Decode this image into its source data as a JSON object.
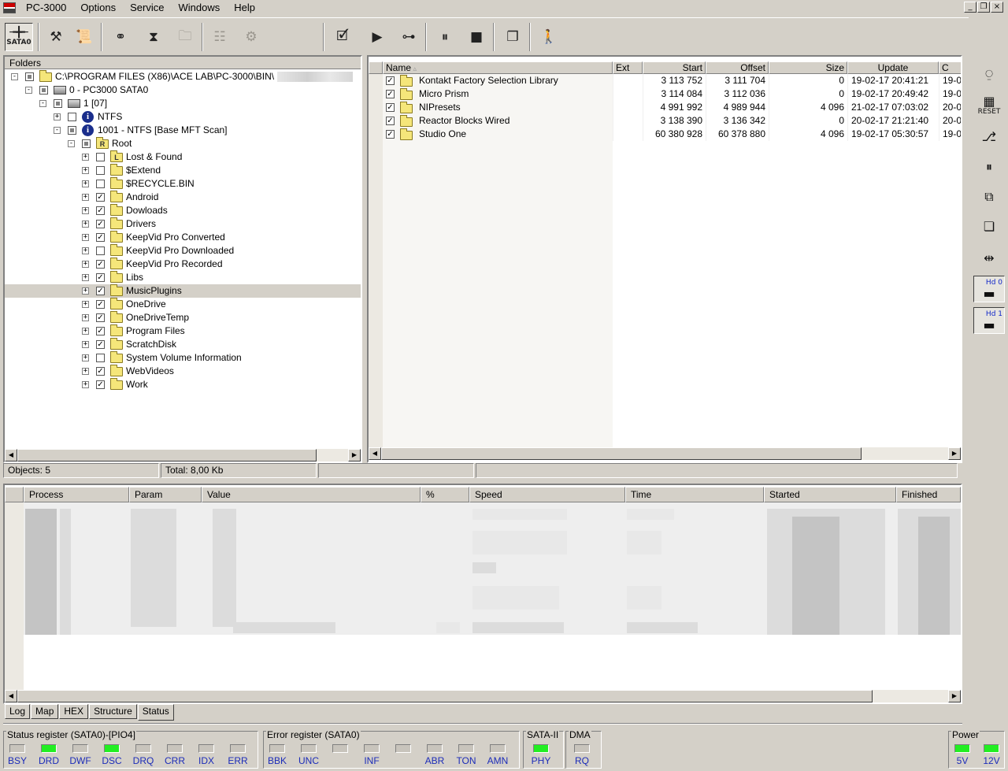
{
  "menu": {
    "app_title": "PC-3000",
    "items": [
      "Options",
      "Service",
      "Windows",
      "Help"
    ]
  },
  "window_controls": {
    "minimize": "_",
    "restore": "❐",
    "close": "×"
  },
  "toolbar": {
    "sata_label": "SATA0"
  },
  "folders": {
    "header": "Folders",
    "tree": [
      {
        "label": "C:\\PROGRAM FILES (X86)\\ACE LAB\\PC-3000\\BIN\\",
        "level": 0,
        "expander": "-",
        "check": "part",
        "icon": "multi-folder"
      },
      {
        "label": "0 - PC3000 SATA0",
        "level": 1,
        "expander": "-",
        "check": "part",
        "icon": "drive"
      },
      {
        "label": "1 [07]",
        "level": 2,
        "expander": "-",
        "check": "part",
        "icon": "disk"
      },
      {
        "label": "NTFS",
        "level": 3,
        "expander": "+",
        "check": "none",
        "icon": "info"
      },
      {
        "label": "1001 - NTFS [Base MFT Scan]",
        "level": 3,
        "expander": "-",
        "check": "part",
        "icon": "info"
      },
      {
        "label": "Root",
        "level": 4,
        "expander": "-",
        "check": "part",
        "icon": "folder-r",
        "icon_letter": "R"
      },
      {
        "label": "Lost & Found",
        "level": 5,
        "expander": "+",
        "check": "none",
        "icon": "folder-l",
        "icon_letter": "L"
      },
      {
        "label": "$Extend",
        "level": 5,
        "expander": "+",
        "check": "none",
        "icon": "folder"
      },
      {
        "label": "$RECYCLE.BIN",
        "level": 5,
        "expander": "+",
        "check": "none",
        "icon": "folder"
      },
      {
        "label": "Android",
        "level": 5,
        "expander": "+",
        "check": "checked",
        "icon": "folder"
      },
      {
        "label": "Dowloads",
        "level": 5,
        "expander": "+",
        "check": "checked",
        "icon": "folder"
      },
      {
        "label": "Drivers",
        "level": 5,
        "expander": "+",
        "check": "checked",
        "icon": "folder"
      },
      {
        "label": "KeepVid Pro Converted",
        "level": 5,
        "expander": "+",
        "check": "checked",
        "icon": "folder"
      },
      {
        "label": "KeepVid Pro Downloaded",
        "level": 5,
        "expander": "+",
        "check": "none",
        "icon": "folder"
      },
      {
        "label": "KeepVid Pro Recorded",
        "level": 5,
        "expander": "+",
        "check": "checked",
        "icon": "folder"
      },
      {
        "label": "Libs",
        "level": 5,
        "expander": "+",
        "check": "checked",
        "icon": "folder"
      },
      {
        "label": "MusicPlugins",
        "level": 5,
        "expander": "+",
        "check": "checked",
        "icon": "folder",
        "selected": true
      },
      {
        "label": "OneDrive",
        "level": 5,
        "expander": "+",
        "check": "checked",
        "icon": "folder"
      },
      {
        "label": "OneDriveTemp",
        "level": 5,
        "expander": "+",
        "check": "checked",
        "icon": "folder"
      },
      {
        "label": "Program Files",
        "level": 5,
        "expander": "+",
        "check": "checked",
        "icon": "folder"
      },
      {
        "label": "ScratchDisk",
        "level": 5,
        "expander": "+",
        "check": "checked",
        "icon": "folder"
      },
      {
        "label": "System Volume Information",
        "level": 5,
        "expander": "+",
        "check": "none",
        "icon": "folder"
      },
      {
        "label": "WebVideos",
        "level": 5,
        "expander": "+",
        "check": "checked",
        "icon": "folder"
      },
      {
        "label": "Work",
        "level": 5,
        "expander": "+",
        "check": "checked",
        "icon": "folder"
      }
    ]
  },
  "files": {
    "columns": [
      "Name",
      "Ext",
      "Start",
      "Offset",
      "Size",
      "Update",
      "C"
    ],
    "rows": [
      {
        "name": "Kontakt Factory Selection Library",
        "ext": "",
        "start": "3 113 752",
        "offset": "3 111 704",
        "size": "0",
        "update": "19-02-17 20:41:21",
        "created": "19-0"
      },
      {
        "name": "Micro Prism",
        "ext": "",
        "start": "3 114 084",
        "offset": "3 112 036",
        "size": "0",
        "update": "19-02-17 20:49:42",
        "created": "19-0"
      },
      {
        "name": "NIPresets",
        "ext": "",
        "start": "4 991 992",
        "offset": "4 989 944",
        "size": "4 096",
        "update": "21-02-17 07:03:02",
        "created": "20-0"
      },
      {
        "name": "Reactor Blocks Wired",
        "ext": "",
        "start": "3 138 390",
        "offset": "3 136 342",
        "size": "0",
        "update": "20-02-17 21:21:40",
        "created": "20-0"
      },
      {
        "name": "Studio One",
        "ext": "",
        "start": "60 380 928",
        "offset": "60 378 880",
        "size": "4 096",
        "update": "19-02-17 05:30:57",
        "created": "19-0"
      }
    ]
  },
  "statusbar": {
    "objects": "Objects: 5",
    "total": "Total: 8,00 Kb"
  },
  "process": {
    "columns": [
      "Process",
      "Param",
      "Value",
      "%",
      "Speed",
      "Time",
      "Started",
      "Finished"
    ]
  },
  "tabs": [
    "Log",
    "Map",
    "HEX",
    "Structure",
    "Status"
  ],
  "active_tab": "Status",
  "sidebar": {
    "reset_label": "RESET",
    "hd0_label": "Hd 0",
    "hd1_label": "Hd 1"
  },
  "registers": {
    "status": {
      "title": "Status register (SATA0)-[PIO4]",
      "leds": [
        {
          "label": "BSY",
          "on": false
        },
        {
          "label": "DRD",
          "on": true
        },
        {
          "label": "DWF",
          "on": false
        },
        {
          "label": "DSC",
          "on": true
        },
        {
          "label": "DRQ",
          "on": false
        },
        {
          "label": "CRR",
          "on": false
        },
        {
          "label": "IDX",
          "on": false
        },
        {
          "label": "ERR",
          "on": false
        }
      ]
    },
    "error": {
      "title": "Error register (SATA0)",
      "leds": [
        {
          "label": "BBK",
          "on": false
        },
        {
          "label": "UNC",
          "on": false
        },
        {
          "label": "",
          "on": false
        },
        {
          "label": "INF",
          "on": false
        },
        {
          "label": "",
          "on": false
        },
        {
          "label": "ABR",
          "on": false
        },
        {
          "label": "TON",
          "on": false
        },
        {
          "label": "AMN",
          "on": false
        }
      ]
    },
    "sata": {
      "title": "SATA-II",
      "leds": [
        {
          "label": "PHY",
          "on": true
        }
      ]
    },
    "dma": {
      "title": "DMA",
      "leds": [
        {
          "label": "RQ",
          "on": false
        }
      ]
    },
    "power": {
      "title": "Power",
      "leds": [
        {
          "label": "5V",
          "on": true
        },
        {
          "label": "12V",
          "on": true
        }
      ]
    }
  },
  "colors": {
    "led_on": "#22ee22",
    "led_off": "#c8c4bc",
    "label_blue": "#1c2cb8"
  }
}
